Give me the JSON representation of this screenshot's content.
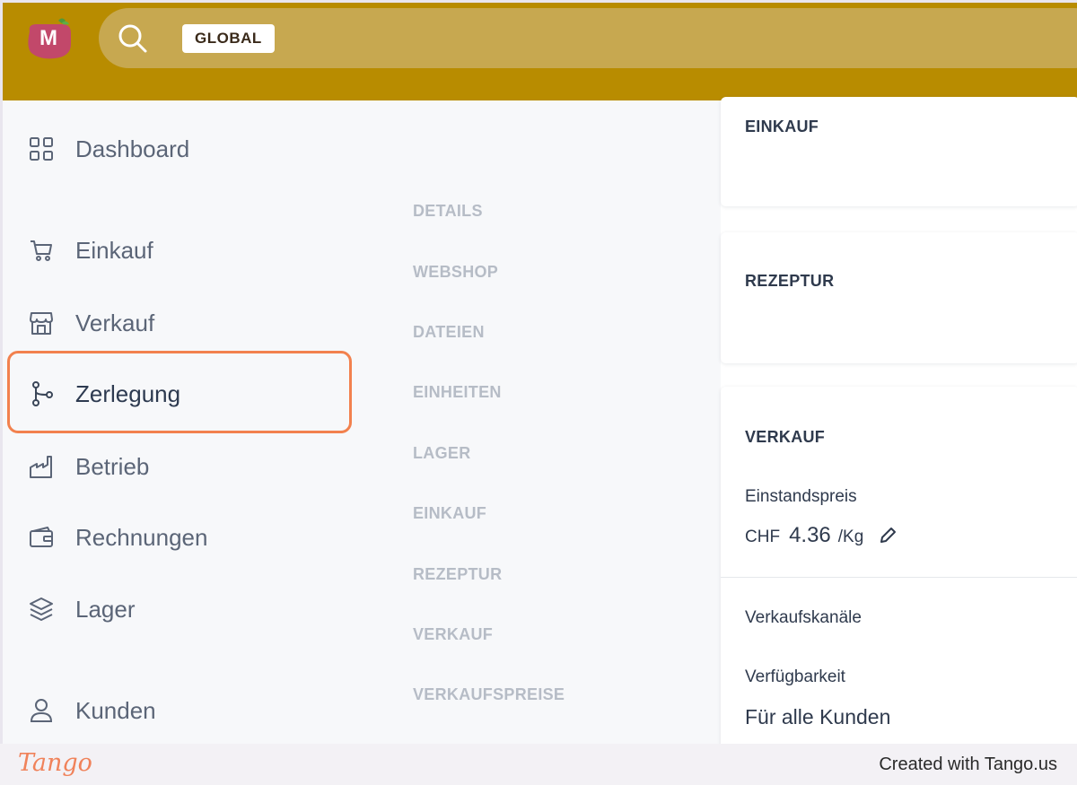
{
  "topbar": {
    "logo_letter": "M",
    "scope_chip": "GLOBAL"
  },
  "sidebar": {
    "items": [
      {
        "label": "Dashboard",
        "icon": "grid-icon"
      },
      {
        "label": "Einkauf",
        "icon": "cart-icon"
      },
      {
        "label": "Verkauf",
        "icon": "store-icon"
      },
      {
        "label": "Zerlegung",
        "icon": "branch-icon",
        "active": true
      },
      {
        "label": "Betrieb",
        "icon": "factory-icon"
      },
      {
        "label": "Rechnungen",
        "icon": "wallet-icon"
      },
      {
        "label": "Lager",
        "icon": "layers-icon"
      },
      {
        "label": "Kunden",
        "icon": "user-icon"
      }
    ]
  },
  "subnav": {
    "items": [
      "DETAILS",
      "WEBSHOP",
      "DATEIEN",
      "EINHEITEN",
      "LAGER",
      "EINKAUF",
      "REZEPTUR",
      "VERKAUF",
      "VERKAUFSPREISE"
    ]
  },
  "cards": {
    "einkauf": {
      "title": "EINKAUF"
    },
    "rezeptur": {
      "title": "REZEPTUR"
    },
    "verkauf": {
      "title": "VERKAUF",
      "einstandspreis_label": "Einstandspreis",
      "currency": "CHF",
      "amount": "4.36",
      "unit": "/Kg",
      "verkaufskanaele_label": "Verkaufskanäle",
      "verfuegbarkeit_label": "Verfügbarkeit",
      "verfuegbarkeit_value": "Für alle Kunden"
    }
  },
  "footer": {
    "logo_text": "Tango",
    "created_with": "Created with Tango.us"
  },
  "colors": {
    "topbar": "#b88c00",
    "searchbar": "#c7a850",
    "active_outline": "#f2814e",
    "sidebar_bg": "#f7f8fa"
  }
}
